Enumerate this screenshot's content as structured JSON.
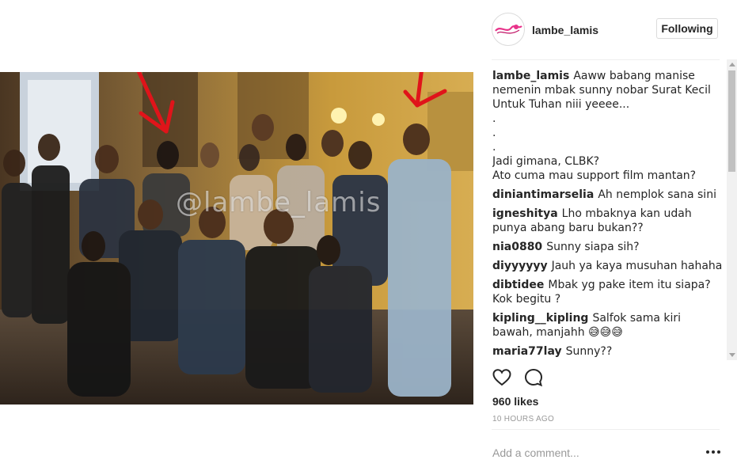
{
  "post": {
    "username": "lambe_lamis",
    "follow_button": "Following",
    "watermark": "@lambe_lamis",
    "caption": {
      "user": "lambe_lamis",
      "lines": [
        "Aaww babang manise nemenin mbak sunny nobar Surat Kecil Untuk Tuhan niii yeeee...",
        ".",
        ".",
        ".",
        "Jadi gimana, CLBK?",
        "Ato cuma mau support film mantan?"
      ]
    },
    "comments": [
      {
        "user": "diniantimarselia",
        "text": "Ah nemplok sana sini"
      },
      {
        "user": "igneshitya",
        "text": "Lho mbaknya kan udah punya abang baru bukan??"
      },
      {
        "user": "nia0880",
        "text": "Sunny siapa sih?"
      },
      {
        "user": "diyyyyyy",
        "text": "Jauh ya kaya musuhan hahaha"
      },
      {
        "user": "dibtidee",
        "text": "Mbak yg pake item itu siapa? Kok begitu ?"
      },
      {
        "user": "kipling__kipling",
        "text": "Salfok sama kiri bawah, manjahh 😅😅😅"
      },
      {
        "user": "maria77lay",
        "text": "Sunny??"
      }
    ],
    "likes": "960 likes",
    "time": "10 HOURS AGO",
    "comment_placeholder": "Add a comment...",
    "icons": {
      "like": "heart-icon",
      "comment": "comment-bubble-icon",
      "more": "more-options-icon"
    },
    "colors": {
      "arrow_annotation": "#e0141a",
      "link": "#262626"
    }
  }
}
